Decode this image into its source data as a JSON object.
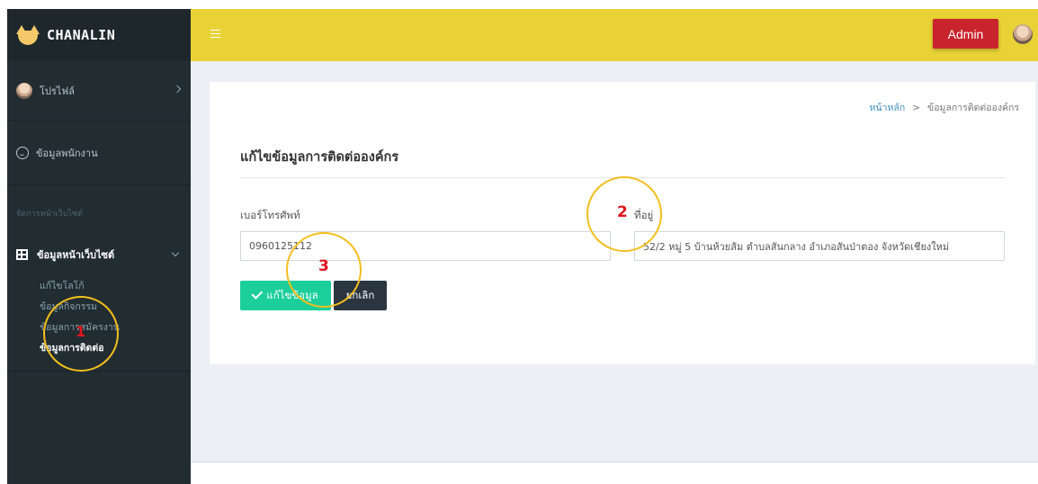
{
  "brand": {
    "name": "CHANALIN"
  },
  "sidebar": {
    "profile_label": "โปรไฟล์",
    "staff_label": "ข้อมูลพนักงาน",
    "section_header": "จัดการหน้าเว็บไซต์",
    "website_menu_label": "ข้อมูลหน้าเว็บไซต์",
    "sub_items": [
      {
        "label": "แก้ไขโลโก้"
      },
      {
        "label": "ข้อมูลกิจกรรม"
      },
      {
        "label": "ข้อมูลการสมัครงาน"
      },
      {
        "label": "ข้อมูลการติดต่อ"
      }
    ]
  },
  "topbar": {
    "admin_label": "Admin"
  },
  "breadcrumb": {
    "home": "หน้าหลัก",
    "separator": ">",
    "current": "ข้อมูลการติดต่อองค์กร"
  },
  "form": {
    "title": "แก้ไขข้อมูลการติดต่อองค์กร",
    "phone_label": "เบอร์โทรศัพท์",
    "phone_value": "0960125112",
    "address_label": "ที่อยู่",
    "address_value": "52/2 หมู่ 5 บ้านห้วยส้ม ตำบลสันกลาง อำเภอสันป่าตอง จังหวัดเชียงใหม่",
    "save_label": "แก้ไขข้อมูล",
    "cancel_label": "ยกเลิก"
  },
  "annotations": [
    {
      "number": "1",
      "color": "#e0141c"
    },
    {
      "number": "2",
      "color": "#e0141c"
    },
    {
      "number": "3",
      "color": "#e0141c"
    }
  ],
  "colors": {
    "topbar": "#e8d235",
    "sidebar": "#222d32",
    "admin_button": "#c9232d",
    "save_button": "#1ccf9a",
    "cancel_button": "#2a3540",
    "annotation_circle": "#f2bf1d"
  }
}
